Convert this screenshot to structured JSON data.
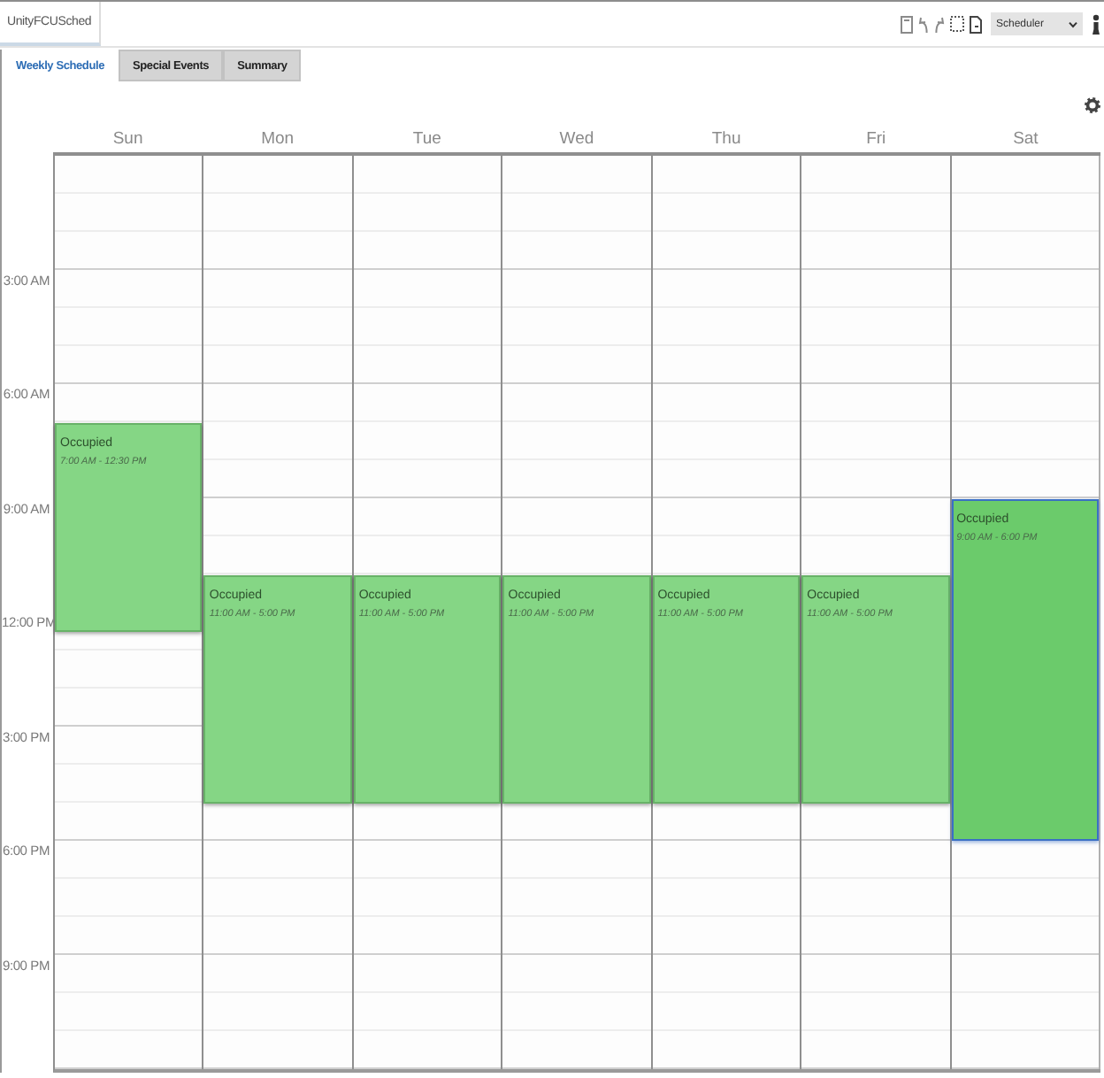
{
  "title_tab": {
    "label": "UnityFCUSched"
  },
  "toolbar": {
    "mode_select": {
      "value": "Scheduler"
    }
  },
  "tabs": [
    {
      "label": "Weekly Schedule",
      "selected": true
    },
    {
      "label": "Special Events",
      "selected": false
    },
    {
      "label": "Summary",
      "selected": false
    }
  ],
  "calendar": {
    "days": [
      {
        "label": "Sun",
        "events": [
          {
            "title": "Occupied",
            "time": "7:00 AM - 12:30 PM",
            "selected": false
          }
        ]
      },
      {
        "label": "Mon",
        "events": [
          {
            "title": "Occupied",
            "time": "11:00 AM - 5:00 PM",
            "selected": false
          }
        ]
      },
      {
        "label": "Tue",
        "events": [
          {
            "title": "Occupied",
            "time": "11:00 AM - 5:00 PM",
            "selected": false
          }
        ]
      },
      {
        "label": "Wed",
        "events": [
          {
            "title": "Occupied",
            "time": "11:00 AM - 5:00 PM",
            "selected": false
          }
        ]
      },
      {
        "label": "Thu",
        "events": [
          {
            "title": "Occupied",
            "time": "11:00 AM - 5:00 PM",
            "selected": false
          }
        ]
      },
      {
        "label": "Fri",
        "events": [
          {
            "title": "Occupied",
            "time": "11:00 AM - 5:00 PM",
            "selected": false
          }
        ]
      },
      {
        "label": "Sat",
        "events": [
          {
            "title": "Occupied",
            "time": "9:00 AM - 6:00 PM",
            "selected": true
          }
        ]
      }
    ],
    "time_labels": [
      "3:00 AM",
      "6:00 AM",
      "9:00 AM",
      "12:00 PM",
      "3:00 PM",
      "6:00 PM",
      "9:00 PM"
    ]
  }
}
